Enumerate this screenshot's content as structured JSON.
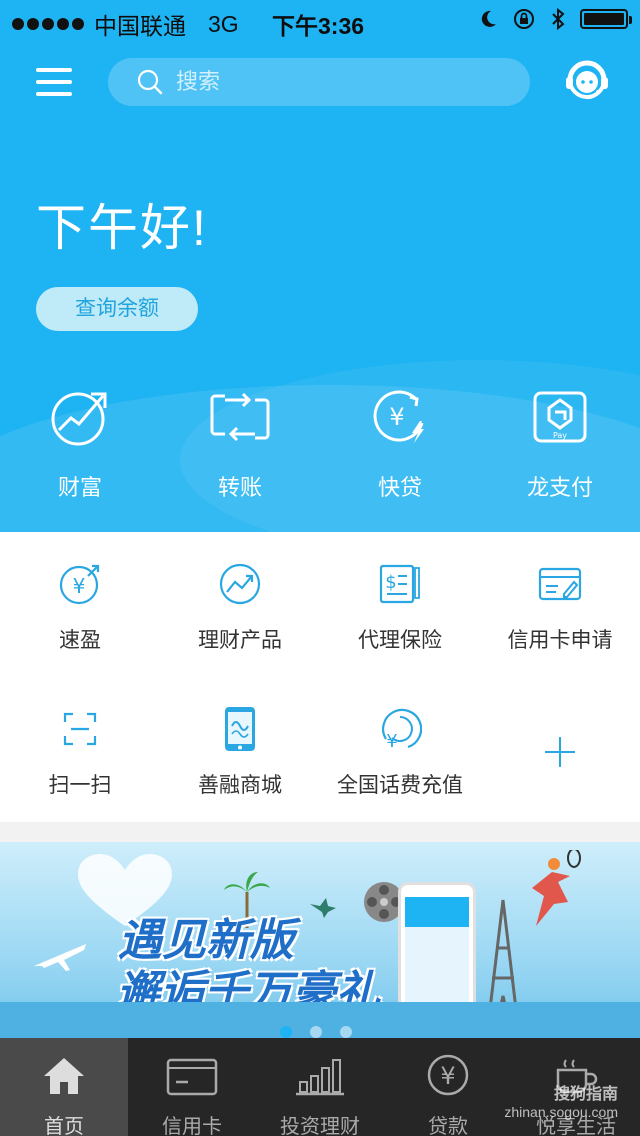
{
  "status_bar": {
    "carrier": "中国联通",
    "network": "3G",
    "time": "下午3:36"
  },
  "header": {
    "search_placeholder": "搜索"
  },
  "hero": {
    "greeting": "下午好!",
    "balance_button": "查询余额"
  },
  "quick_actions": [
    {
      "label": "财富",
      "icon": "wealth-growth-icon"
    },
    {
      "label": "转账",
      "icon": "transfer-icon"
    },
    {
      "label": "快贷",
      "icon": "quick-loan-icon"
    },
    {
      "label": "龙支付",
      "icon": "dragon-pay-icon"
    }
  ],
  "services": [
    {
      "label": "速盈",
      "icon": "yen-circle-icon"
    },
    {
      "label": "理财产品",
      "icon": "trend-chart-icon"
    },
    {
      "label": "代理保险",
      "icon": "insurance-doc-icon"
    },
    {
      "label": "信用卡申请",
      "icon": "credit-card-edit-icon"
    },
    {
      "label": "扫一扫",
      "icon": "scan-icon"
    },
    {
      "label": "善融商城",
      "icon": "phone-mall-icon"
    },
    {
      "label": "全国话费充值",
      "icon": "phone-recharge-icon"
    }
  ],
  "banner": {
    "line1": "遇见新版",
    "line2": "邂逅千万豪礼"
  },
  "tabs": [
    {
      "label": "首页",
      "icon": "home-icon",
      "active": true
    },
    {
      "label": "信用卡",
      "icon": "card-icon",
      "active": false
    },
    {
      "label": "投资理财",
      "icon": "bar-chart-icon",
      "active": false
    },
    {
      "label": "贷款",
      "icon": "yen-coin-icon",
      "active": false
    },
    {
      "label": "悦享生活",
      "icon": "coffee-cup-icon",
      "active": false
    }
  ],
  "watermark": {
    "line1": "搜狗指南",
    "line2": "zhinan.sogou.com"
  },
  "colors": {
    "primary": "#1eb3f2",
    "icon_blue": "#2aa7e2",
    "tab_bg": "#262626"
  }
}
